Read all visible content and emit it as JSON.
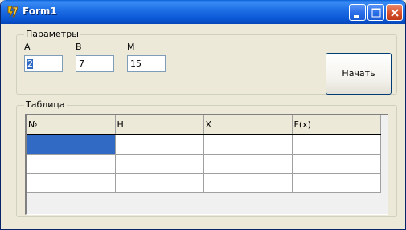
{
  "window": {
    "title": "Form1",
    "app_icon": "delphi-icon",
    "controls": {
      "minimize": "minimize-icon",
      "maximize": "maximize-icon",
      "close": "close-icon"
    }
  },
  "params": {
    "group_label": "Параметры",
    "fields": [
      {
        "label": "A",
        "value": "2"
      },
      {
        "label": "B",
        "value": "7"
      },
      {
        "label": "M",
        "value": "15"
      }
    ],
    "start_button": "Начать"
  },
  "table": {
    "group_label": "Таблица",
    "columns": [
      "№",
      "H",
      "X",
      "F(x)"
    ],
    "rows": [
      [
        "",
        "",
        "",
        ""
      ],
      [
        "",
        "",
        "",
        ""
      ],
      [
        "",
        "",
        "",
        ""
      ]
    ],
    "selected_cell": {
      "row": 0,
      "col": 0
    },
    "colors": {
      "selection": "#316ac5"
    }
  }
}
